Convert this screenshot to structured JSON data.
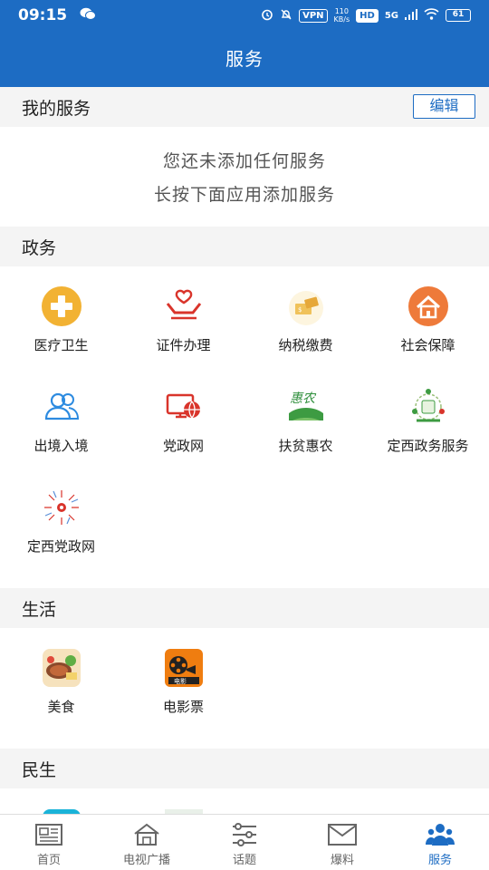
{
  "status_bar": {
    "time": "09:15",
    "vpn": "VPN",
    "speed_value": "110",
    "speed_unit": "KB/s",
    "hd": "HD",
    "network": "5G",
    "battery": "61"
  },
  "header": {
    "title": "服务"
  },
  "my_services": {
    "title": "我的服务",
    "edit_label": "编辑",
    "empty_line1": "您还未添加任何服务",
    "empty_line2": "长按下面应用添加服务"
  },
  "sections": {
    "government": {
      "title": "政务",
      "items": [
        {
          "label": "医疗卫生",
          "icon": "medical-cross-icon"
        },
        {
          "label": "证件办理",
          "icon": "hands-heart-icon"
        },
        {
          "label": "纳税缴费",
          "icon": "tax-payment-icon"
        },
        {
          "label": "社会保障",
          "icon": "house-icon"
        },
        {
          "label": "出境入境",
          "icon": "people-icon"
        },
        {
          "label": "党政网",
          "icon": "party-network-icon"
        },
        {
          "label": "扶贫惠农",
          "icon": "huinong-icon"
        },
        {
          "label": "定西政务服务",
          "icon": "dingxi-gov-icon"
        },
        {
          "label": "定西党政网",
          "icon": "dingxi-party-icon"
        }
      ]
    },
    "life": {
      "title": "生活",
      "items": [
        {
          "label": "美食",
          "icon": "food-icon"
        },
        {
          "label": "电影票",
          "icon": "movie-ticket-icon"
        }
      ]
    },
    "livelihood": {
      "title": "民生",
      "items": [
        {
          "label": "",
          "icon": "travel-icon"
        },
        {
          "label": "",
          "icon": "monitor-icon"
        }
      ]
    }
  },
  "tabs": [
    {
      "label": "首页",
      "icon": "newspaper-icon",
      "active": false
    },
    {
      "label": "电视广播",
      "icon": "tv-house-icon",
      "active": false
    },
    {
      "label": "话题",
      "icon": "sliders-icon",
      "active": false
    },
    {
      "label": "爆料",
      "icon": "envelope-icon",
      "active": false
    },
    {
      "label": "服务",
      "icon": "users-icon",
      "active": true
    }
  ],
  "colors": {
    "primary": "#1d6cc3",
    "section_bg": "#f4f4f4",
    "inactive_tab": "#666666"
  }
}
